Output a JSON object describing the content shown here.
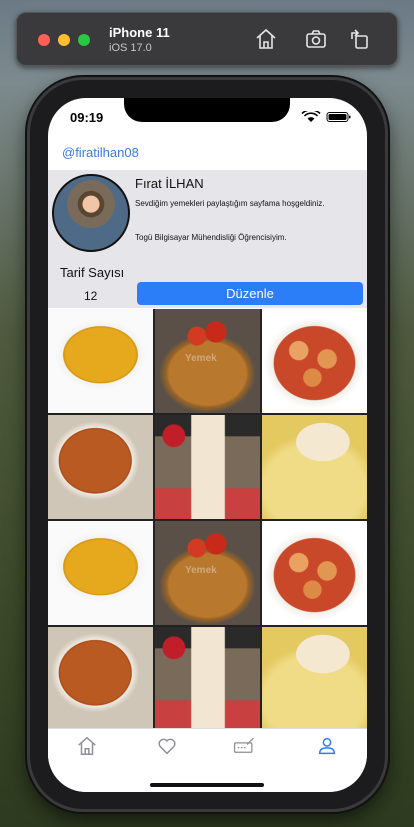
{
  "simulator": {
    "device_name": "iPhone 11",
    "os_version": "iOS 17.0",
    "icons": [
      "home-icon",
      "camera-icon",
      "rotate-icon"
    ]
  },
  "status_bar": {
    "time": "09:19",
    "icons": [
      "wifi-icon",
      "battery-icon"
    ]
  },
  "profile": {
    "username": "@firatilhan08",
    "full_name": "Fırat İLHAN",
    "bio_line1": "Sevdiğim yemekleri paylaştığım sayfama hoşgeldiniz.",
    "bio_line2": "Togü Bilgisayar Mühendisliği Öğrencisiyim.",
    "recipe_count_label": "Tarif Sayısı",
    "recipe_count": "12",
    "edit_button_label": "Düzenle"
  },
  "grid": {
    "tiles": [
      {
        "image": "lentil-soup"
      },
      {
        "image": "bulgur-pilaf",
        "watermark": "Yemek"
      },
      {
        "image": "chicken-saute"
      },
      {
        "image": "tarhana-soup"
      },
      {
        "image": "jar-dessert"
      },
      {
        "image": "kuymak-cheese"
      },
      {
        "image": "lentil-soup"
      },
      {
        "image": "bulgur-pilaf",
        "watermark": "Yemek"
      },
      {
        "image": "chicken-saute"
      },
      {
        "image": "tarhana-soup"
      },
      {
        "image": "jar-dessert"
      },
      {
        "image": "kuymak-cheese"
      }
    ]
  },
  "tab_bar": {
    "tabs": [
      {
        "icon": "home-icon",
        "active": false
      },
      {
        "icon": "heart-icon",
        "active": false
      },
      {
        "icon": "edit-icon",
        "active": false
      },
      {
        "icon": "person-icon",
        "active": true
      }
    ],
    "active_color": "#2c7ef8",
    "inactive_color": "#8e8e93"
  },
  "colors": {
    "accent": "#2c7ef8",
    "username": "#3a7bd5",
    "profile_band": "#e6e6ea"
  }
}
